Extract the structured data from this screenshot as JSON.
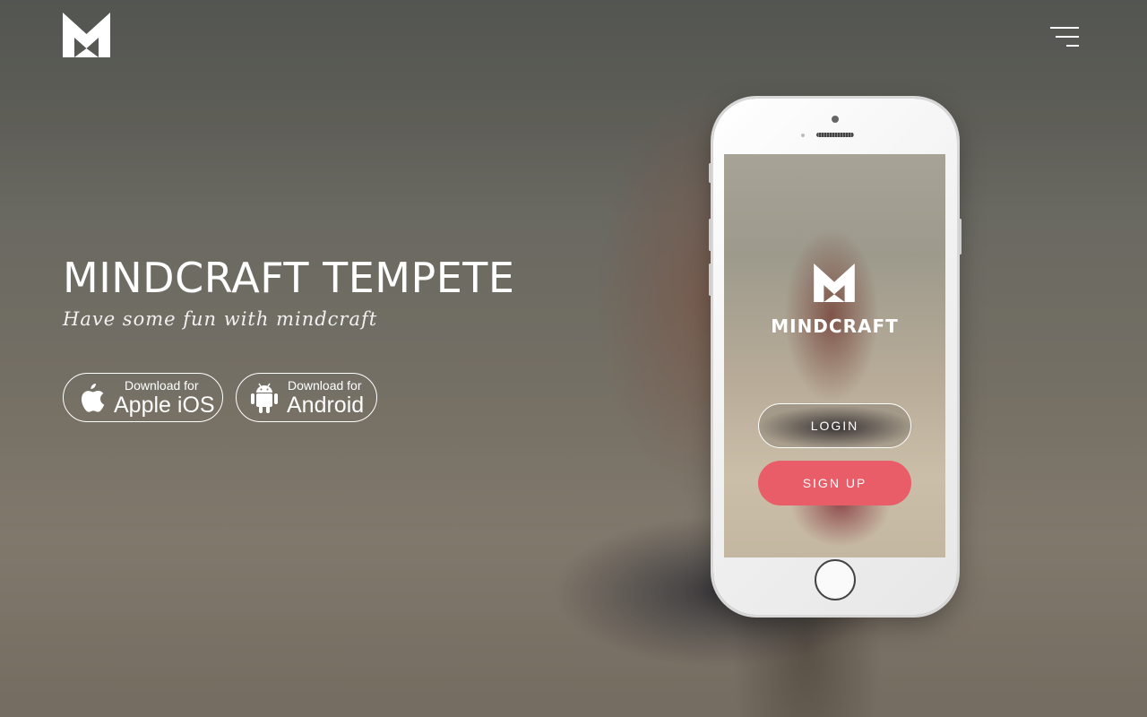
{
  "brand": {
    "logo_icon": "mindcraft-m-logo-icon"
  },
  "menu": {
    "icon": "hamburger-menu-icon"
  },
  "hero": {
    "title": "MINDCRAFT TEMPETE",
    "subtitle": "Have some fun with mindcraft"
  },
  "downloads": [
    {
      "small_label": "Download for",
      "platform_label": "Apple iOS",
      "icon": "apple-icon"
    },
    {
      "small_label": "Download for",
      "platform_label": "Android",
      "icon": "android-icon"
    }
  ],
  "phone_screen": {
    "app_title": "MINDCRAFT",
    "login_label": "LOGIN",
    "signup_label": "SIGN UP"
  },
  "colors": {
    "accent": "#e85d68",
    "text": "#ffffff"
  }
}
